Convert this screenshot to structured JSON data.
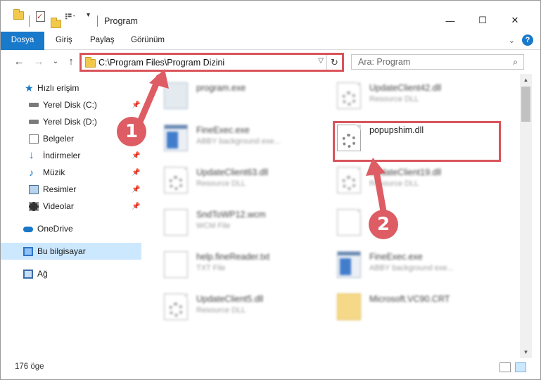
{
  "window": {
    "title": "Program",
    "controls": {
      "minimize": "—",
      "maximize": "☐",
      "close": "✕"
    }
  },
  "ribbon": {
    "tabs": [
      {
        "label": "Dosya"
      },
      {
        "label": "Giriş"
      },
      {
        "label": "Paylaş"
      },
      {
        "label": "Görünüm"
      }
    ],
    "expand_icon": "chevron-down-icon",
    "help_label": "?"
  },
  "nav": {
    "back": "←",
    "forward": "→",
    "recent": "⌄",
    "up": "↑",
    "address": "C:\\Program Files\\Program Dizini",
    "address_dropdown": "▽",
    "refresh": "↻",
    "search_placeholder": "Ara: Program",
    "search_icon": "⌕"
  },
  "sidebar": {
    "items": [
      {
        "label": "Hızlı erişim",
        "icon": "star-icon",
        "pinned": false
      },
      {
        "label": "Yerel Disk (C:)",
        "icon": "drive-icon",
        "pinned": true
      },
      {
        "label": "Yerel Disk (D:)",
        "icon": "drive-icon",
        "pinned": false
      },
      {
        "label": "Belgeler",
        "icon": "documents-icon",
        "pinned": true
      },
      {
        "label": "İndirmeler",
        "icon": "downloads-icon",
        "pinned": true
      },
      {
        "label": "Müzik",
        "icon": "music-icon",
        "pinned": true
      },
      {
        "label": "Resimler",
        "icon": "pictures-icon",
        "pinned": true
      },
      {
        "label": "Videolar",
        "icon": "videos-icon",
        "pinned": true
      },
      {
        "label": "OneDrive",
        "icon": "onedrive-icon",
        "pinned": false
      },
      {
        "label": "Bu bilgisayar",
        "icon": "this-pc-icon",
        "pinned": false,
        "selected": true
      },
      {
        "label": "Ağ",
        "icon": "network-icon",
        "pinned": false
      }
    ]
  },
  "files": [
    {
      "name": "program.exe",
      "desc": "",
      "icon": "program-icon",
      "blurred": true
    },
    {
      "name": "UpdateClient42.dll",
      "desc": "Resource DLL",
      "icon": "dll-icon",
      "blurred": true
    },
    {
      "name": "FineExec.exe",
      "desc": "ABBY background exe...",
      "icon": "exe-icon",
      "blurred": true
    },
    {
      "name": "popupshim.dll",
      "desc": "",
      "icon": "dll-icon",
      "blurred": false,
      "highlighted": true
    },
    {
      "name": "UpdateClient63.dll",
      "desc": "Resource DLL",
      "icon": "dll-icon",
      "blurred": true
    },
    {
      "name": "UpdateClient19.dll",
      "desc": "Resource DLL",
      "icon": "dll-icon",
      "blurred": true
    },
    {
      "name": "SndToWP12.wcm",
      "desc": "WCM File",
      "icon": "file-icon",
      "blurred": true
    },
    {
      "name": "",
      "desc": "",
      "icon": "file-icon",
      "blurred": true
    },
    {
      "name": "help.fineReader.txt",
      "desc": "TXT File",
      "icon": "text-file-icon",
      "blurred": true
    },
    {
      "name": "FineExec.exe",
      "desc": "ABBY background exe...",
      "icon": "exe-icon",
      "blurred": true
    },
    {
      "name": "UpdateClient5.dll",
      "desc": "Resource DLL",
      "icon": "dll-icon",
      "blurred": true
    },
    {
      "name": "Microsoft.VC90.CRT",
      "desc": "",
      "icon": "folder-icon",
      "blurred": true
    }
  ],
  "status": {
    "item_count": "176 öge"
  },
  "annotations": {
    "marker1": "1",
    "marker2": "2",
    "color": "#de5c63"
  },
  "colors": {
    "accent": "#1979ca",
    "highlight": "#d9545a",
    "selected_bg": "#cce8ff"
  }
}
